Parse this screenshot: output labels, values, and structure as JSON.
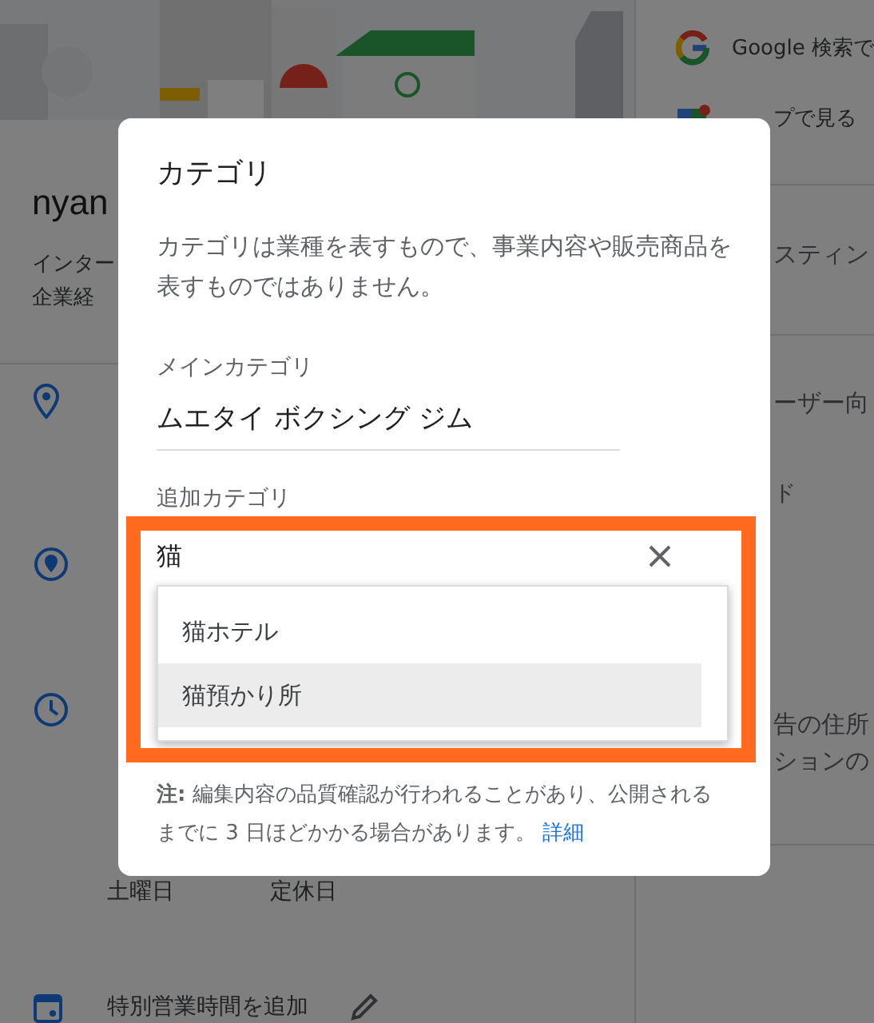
{
  "background": {
    "business_name": "nyan",
    "subtitle_lines": [
      "インター",
      "企業経"
    ],
    "info_rows": [
      {
        "kind": "pin"
      },
      {
        "kind": "place"
      },
      {
        "kind": "clock"
      }
    ],
    "saturday": {
      "day": "土曜日",
      "value": "定休日"
    },
    "special_hours": {
      "label": "特別営業時間を追加"
    },
    "side_links": [
      {
        "kind": "google",
        "label": "Google 検索で"
      },
      {
        "kind": "map",
        "label": "プで見る"
      }
    ],
    "side_sections": [
      {
        "lines": [
          "スティン"
        ]
      },
      {
        "lines": [
          "ーザー向",
          "ド"
        ]
      },
      {
        "lines": [
          "告の住所",
          "ションの"
        ]
      }
    ]
  },
  "dialog": {
    "title": "カテゴリ",
    "description": "カテゴリは業種を表すもので、事業内容や販売商品を表すものではありません。",
    "main_category": {
      "label": "メインカテゴリ",
      "value": "ムエタイ ボクシング ジム"
    },
    "additional_category": {
      "label": "追加カテゴリ",
      "value": "猫",
      "suggestions": [
        {
          "label": "猫ホテル",
          "selected": false
        },
        {
          "label": "猫預かり所",
          "selected": true
        }
      ]
    },
    "note": {
      "text": "**注:** 編集内容の品質確認が行われることがあり、公開されるまでに 3 日ほどかかる場合があります。",
      "link": "詳細"
    }
  }
}
